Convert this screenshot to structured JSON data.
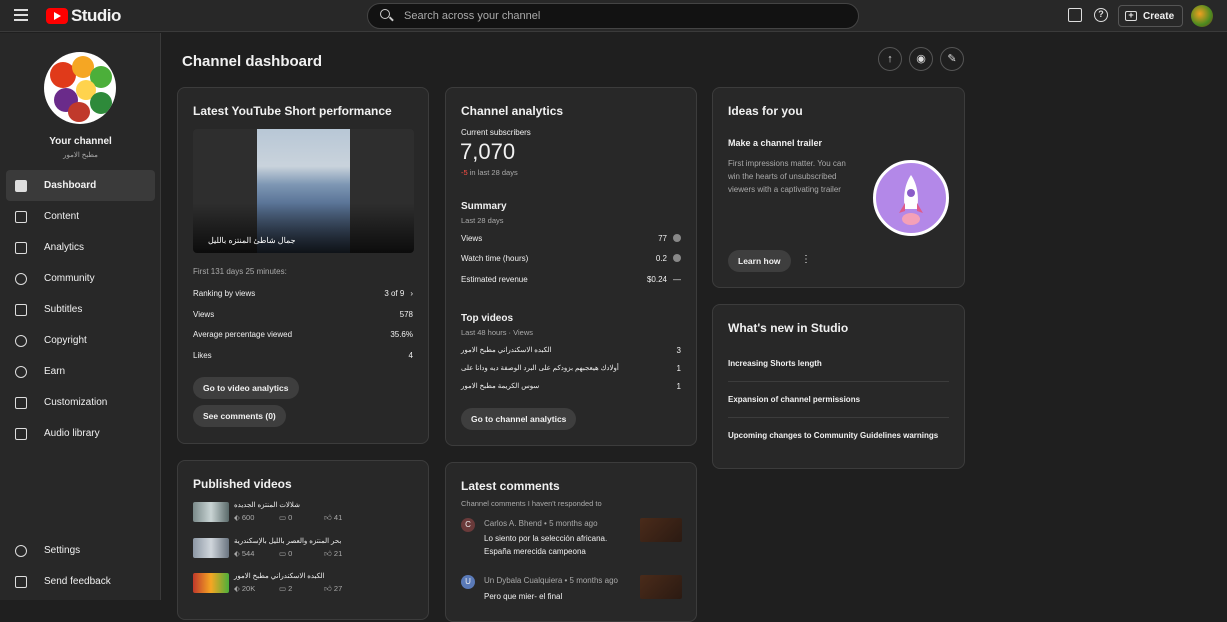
{
  "app": {
    "logo_text": "Studio"
  },
  "search": {
    "placeholder": "Search across your channel"
  },
  "topbar": {
    "create_label": "Create",
    "help_glyph": "?"
  },
  "channel": {
    "label": "Your channel",
    "name": "مطبخ الامور"
  },
  "nav": {
    "items": [
      {
        "label": "Dashboard",
        "icon": "dashboard-icon",
        "active": true
      },
      {
        "label": "Content",
        "icon": "content-icon"
      },
      {
        "label": "Analytics",
        "icon": "analytics-icon"
      },
      {
        "label": "Community",
        "icon": "community-icon"
      },
      {
        "label": "Subtitles",
        "icon": "subtitles-icon"
      },
      {
        "label": "Copyright",
        "icon": "copyright-icon"
      },
      {
        "label": "Earn",
        "icon": "earn-icon"
      },
      {
        "label": "Customization",
        "icon": "customization-icon"
      },
      {
        "label": "Audio library",
        "icon": "audio-library-icon"
      }
    ],
    "bottom": [
      {
        "label": "Settings",
        "icon": "gear-icon"
      },
      {
        "label": "Send feedback",
        "icon": "feedback-icon"
      }
    ]
  },
  "page": {
    "title": "Channel dashboard"
  },
  "short_perf": {
    "title": "Latest YouTube Short performance",
    "caption": "جمال شاطئ المنتزه بالليل",
    "period": "First 131 days 25 minutes:",
    "ranking_label": "Ranking by views",
    "ranking_value": "3 of 9",
    "views_label": "Views",
    "views_value": "578",
    "avg_label": "Average percentage viewed",
    "avg_value": "35.6%",
    "likes_label": "Likes",
    "likes_value": "4",
    "btn_analytics": "Go to video analytics",
    "btn_comments": "See comments (0)"
  },
  "analytics": {
    "title": "Channel analytics",
    "subs_label": "Current subscribers",
    "subs_value": "7,070",
    "subs_change": "-5",
    "subs_change_period": " in last 28 days",
    "summary_title": "Summary",
    "summary_period": "Last 28 days",
    "views_label": "Views",
    "views_value": "77",
    "watch_label": "Watch time (hours)",
    "watch_value": "0.2",
    "rev_label": "Estimated revenue",
    "rev_value": "$0.24",
    "rev_trend": "—",
    "top_title": "Top videos",
    "top_period": "Last 48 hours · Views",
    "top_videos": [
      {
        "title": "الكبده الاسكندراني مطبخ الامور",
        "views": "3"
      },
      {
        "title": "أولادك هيعجبهم بزودكم على البرد الوصفة ديه ودانا على",
        "views": "1"
      },
      {
        "title": "سوس الكريمة مطبخ الامور",
        "views": "1"
      }
    ],
    "btn": "Go to channel analytics"
  },
  "ideas": {
    "title": "Ideas for you",
    "subtitle": "Make a channel trailer",
    "text": "First impressions matter. You can win the hearts of unsubscribed viewers with a captivating trailer",
    "btn": "Learn how"
  },
  "whats_new": {
    "title": "What's new in Studio",
    "items": [
      "Increasing Shorts length",
      "Expansion of channel permissions",
      "Upcoming changes to Community Guidelines warnings"
    ]
  },
  "published": {
    "title": "Published videos",
    "videos": [
      {
        "title": "شلالات المنتزه الجديده",
        "views": "600",
        "comments": "0",
        "likes": "41"
      },
      {
        "title": "بحر المنتزه والعصر بالليل بالإسكندرية",
        "views": "544",
        "comments": "0",
        "likes": "21"
      },
      {
        "title": "الكبده الاسكندراني مطبخ الامور",
        "views": "20K",
        "comments": "2",
        "likes": "27"
      }
    ]
  },
  "comments": {
    "title": "Latest comments",
    "subtitle": "Channel comments I haven't responded to",
    "items": [
      {
        "initial": "C",
        "author": "Carlos A. Bhend",
        "time": "5 months ago",
        "text": "Lo siento por la selección africana. España merecida campeona"
      },
      {
        "initial": "U",
        "author": "Un Dybala Cualquiera",
        "time": "5 months ago",
        "text": "Pero que mier- el final"
      }
    ]
  },
  "colors": {
    "accent_red": "#ff0000",
    "negative": "#ff4e45",
    "card_bg": "#282828"
  }
}
